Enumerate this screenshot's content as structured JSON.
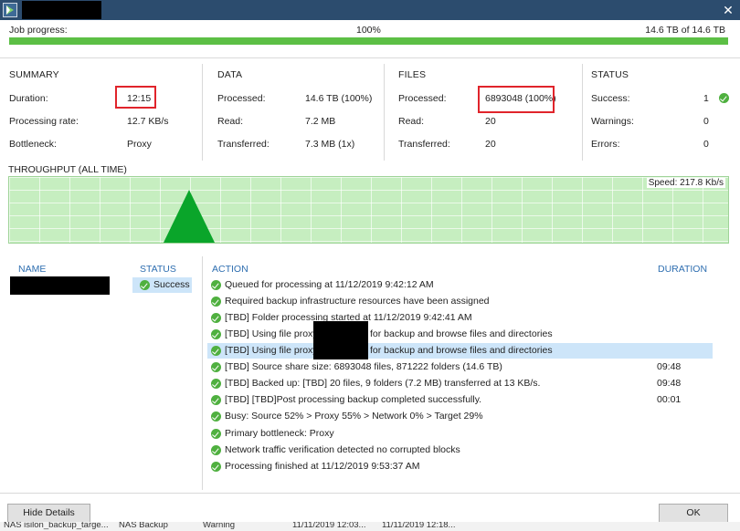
{
  "window": {
    "close_glyph": "✕",
    "icon": "veeam-arrow-icon"
  },
  "progress": {
    "label": "Job progress:",
    "percent_text": "100%",
    "fraction": 1.0,
    "size_text": "14.6 TB of 14.6 TB",
    "color": "#5cbf45"
  },
  "summary": {
    "heading": "SUMMARY",
    "rows": [
      {
        "label": "Duration:",
        "value": "12:15"
      },
      {
        "label": "Processing rate:",
        "value": "12.7 KB/s"
      },
      {
        "label": "Bottleneck:",
        "value": "Proxy"
      }
    ]
  },
  "data_section": {
    "heading": "DATA",
    "rows": [
      {
        "label": "Processed:",
        "value": "14.6 TB (100%)"
      },
      {
        "label": "Read:",
        "value": "7.2 MB"
      },
      {
        "label": "Transferred:",
        "value": "7.3 MB (1x)"
      }
    ]
  },
  "files": {
    "heading": "FILES",
    "rows": [
      {
        "label": "Processed:",
        "value": "6893048 (100%)"
      },
      {
        "label": "Read:",
        "value": "20"
      },
      {
        "label": "Transferred:",
        "value": "20"
      }
    ]
  },
  "status_section": {
    "heading": "STATUS",
    "rows": [
      {
        "label": "Success:",
        "value": "1"
      },
      {
        "label": "Warnings:",
        "value": "0"
      },
      {
        "label": "Errors:",
        "value": "0"
      }
    ]
  },
  "throughput": {
    "title": "THROUGHPUT (ALL TIME)",
    "speed": "Speed: 217.8 Kb/s",
    "fill_color": "#c6eec0",
    "peak_color": "#0aa52a"
  },
  "objects": {
    "name_header": "NAME",
    "status_header": "STATUS",
    "rows": [
      {
        "status": "Success"
      }
    ]
  },
  "log": {
    "action_header": "ACTION",
    "duration_header": "DURATION",
    "rows": [
      {
        "text": "Queued for processing at 11/12/2019 9:42:12 AM",
        "duration": ""
      },
      {
        "text": "Required backup infrastructure resources have been assigned",
        "duration": ""
      },
      {
        "text": "[TBD] Folder processing started at 11/12/2019 9:42:41 AM",
        "duration": ""
      },
      {
        "text": "[TBD] Using file proxy",
        "text_after": "for backup and browse files and directories",
        "duration": ""
      },
      {
        "text": "[TBD] Using file proxy",
        "text_after": "for backup and browse files and directories",
        "duration": ""
      },
      {
        "text": "[TBD] Source share size: 6893048 files, 871222 folders (14.6 TB)",
        "duration": "09:48"
      },
      {
        "text": "[TBD] Backed up: [TBD] 20 files, 9 folders (7.2 MB) transferred at 13 KB/s.",
        "duration": "09:48"
      },
      {
        "text": "[TBD] [TBD]Post processing backup completed successfully.",
        "duration": "00:01"
      },
      {
        "text": "Busy: Source 52% > Proxy 55% > Network 0% > Target 29%",
        "duration": ""
      },
      {
        "text": "Primary bottleneck: Proxy",
        "duration": ""
      },
      {
        "text": "Network traffic verification detected no corrupted blocks",
        "duration": ""
      },
      {
        "text": "Processing finished at 11/12/2019 9:53:37 AM",
        "duration": ""
      }
    ]
  },
  "footer": {
    "hide_details": "Hide Details",
    "ok": "OK"
  },
  "background_row": {
    "c1": "NAS isilon_backup_targe...",
    "c2": "NAS Backup",
    "c3": "Warning",
    "c4": "11/11/2019 12:03...",
    "c5": "11/11/2019 12:18..."
  }
}
